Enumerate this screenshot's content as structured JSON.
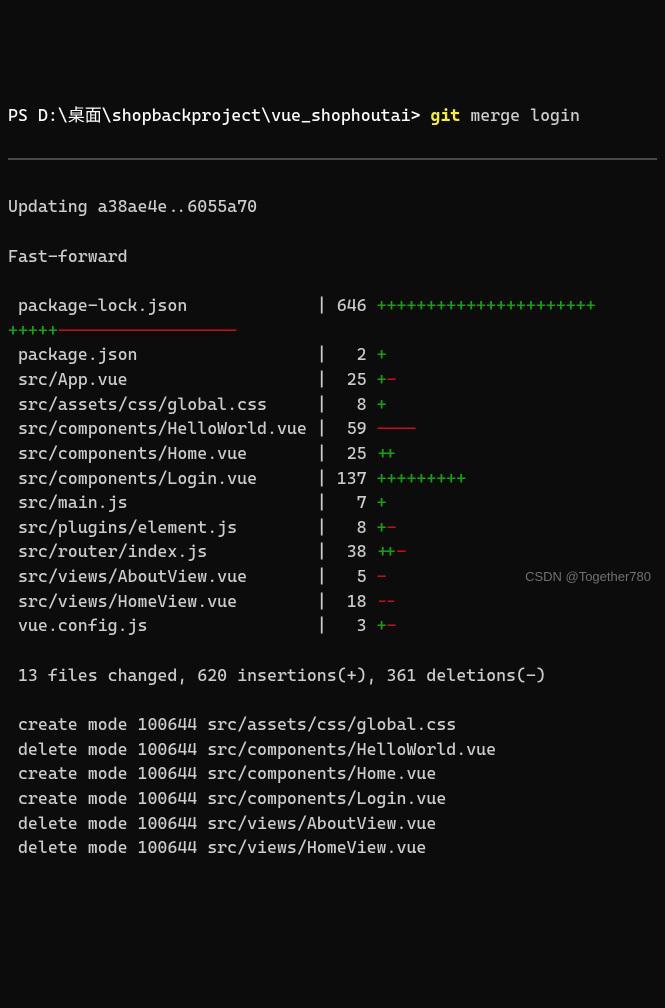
{
  "prompt": {
    "ps": "PS ",
    "path": "D:\\桌面\\shopbackproject\\vue_shophoutai> ",
    "cmd": "git",
    "args": " merge login"
  },
  "updating": "Updating a38ae4e..6055a70",
  "fastforward": "Fast-forward",
  "files": [
    {
      "name": " package-lock.json             ",
      "sep": "| ",
      "num": "646 ",
      "marks": [
        [
          "+",
          "++++++++++++++++++++++"
        ]
      ],
      "wrap": true,
      "wrap_marks": [
        [
          "+",
          "+++++"
        ],
        [
          "-",
          "------------------"
        ]
      ]
    },
    {
      "name": " package.json                  ",
      "sep": "|   ",
      "num": "2 ",
      "marks": [
        [
          "+",
          "+"
        ]
      ]
    },
    {
      "name": " src/App.vue                   ",
      "sep": "|  ",
      "num": "25 ",
      "marks": [
        [
          "+",
          "+"
        ],
        [
          "-",
          "-"
        ]
      ]
    },
    {
      "name": " src/assets/css/global.css     ",
      "sep": "|   ",
      "num": "8 ",
      "marks": [
        [
          "+",
          "+"
        ]
      ]
    },
    {
      "name": " src/components/HelloWorld.vue ",
      "sep": "|  ",
      "num": "59 ",
      "marks": [
        [
          "-",
          "----"
        ]
      ]
    },
    {
      "name": " src/components/Home.vue       ",
      "sep": "|  ",
      "num": "25 ",
      "marks": [
        [
          "+",
          "++"
        ]
      ]
    },
    {
      "name": " src/components/Login.vue      ",
      "sep": "| ",
      "num": "137 ",
      "marks": [
        [
          "+",
          "+++++++++"
        ]
      ]
    },
    {
      "name": " src/main.js                   ",
      "sep": "|   ",
      "num": "7 ",
      "marks": [
        [
          "+",
          "+"
        ]
      ]
    },
    {
      "name": " src/plugins/element.js        ",
      "sep": "|   ",
      "num": "8 ",
      "marks": [
        [
          "+",
          "+"
        ],
        [
          "-",
          "-"
        ]
      ]
    },
    {
      "name": " src/router/index.js           ",
      "sep": "|  ",
      "num": "38 ",
      "marks": [
        [
          "+",
          "++"
        ],
        [
          "-",
          "-"
        ]
      ]
    },
    {
      "name": " src/views/AboutView.vue       ",
      "sep": "|   ",
      "num": "5 ",
      "marks": [
        [
          "-",
          "-"
        ]
      ]
    },
    {
      "name": " src/views/HomeView.vue        ",
      "sep": "|  ",
      "num": "18 ",
      "marks": [
        [
          "-",
          "--"
        ]
      ]
    },
    {
      "name": " vue.config.js                 ",
      "sep": "|   ",
      "num": "3 ",
      "marks": [
        [
          "+",
          "+"
        ],
        [
          "-",
          "-"
        ]
      ]
    }
  ],
  "summary": " 13 files changed, 620 insertions(+), 361 deletions(-)",
  "modes": [
    " create mode 100644 src/assets/css/global.css",
    " delete mode 100644 src/components/HelloWorld.vue",
    " create mode 100644 src/components/Home.vue",
    " create mode 100644 src/components/Login.vue",
    " delete mode 100644 src/views/AboutView.vue",
    " delete mode 100644 src/views/HomeView.vue"
  ],
  "watermark": "CSDN @Together780"
}
